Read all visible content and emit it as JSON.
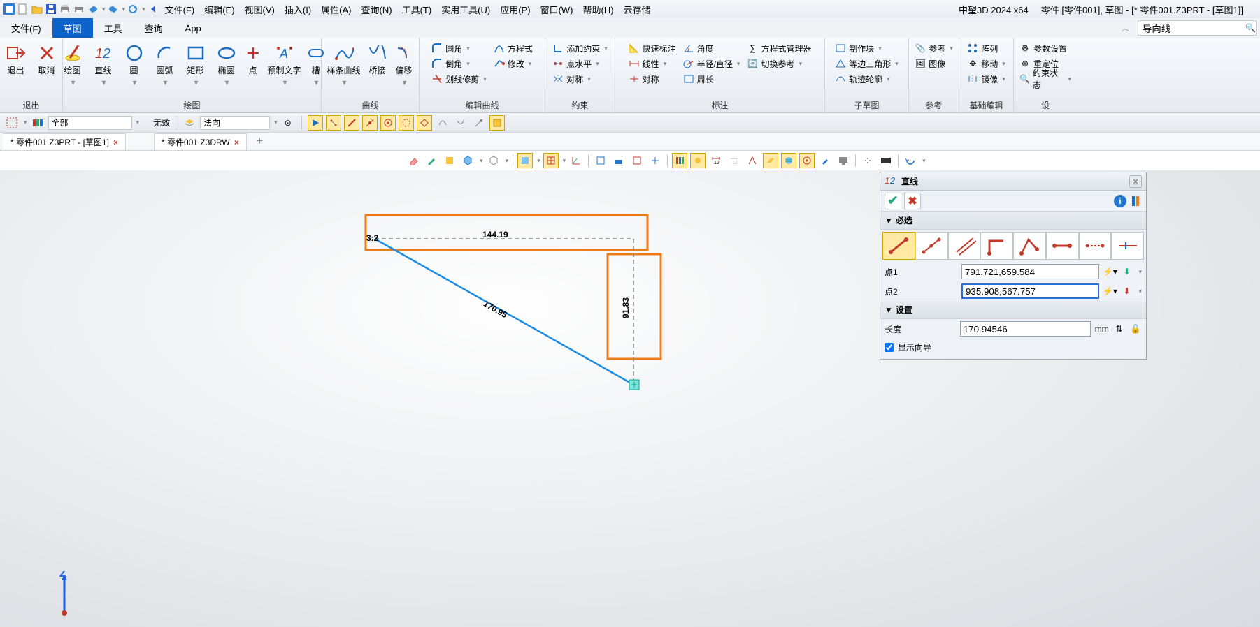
{
  "title": {
    "app": "中望3D 2024 x64",
    "doc": "零件 [零件001], 草图 - [* 零件001.Z3PRT - [草图1]]"
  },
  "menus": [
    "文件(F)",
    "编辑(E)",
    "视图(V)",
    "插入(I)",
    "属性(A)",
    "查询(N)",
    "工具(T)",
    "实用工具(U)",
    "应用(P)",
    "窗口(W)",
    "帮助(H)",
    "云存储"
  ],
  "tabs": [
    "文件(F)",
    "草图",
    "工具",
    "查询",
    "App"
  ],
  "search": {
    "placeholder": "导向线"
  },
  "ribbon": {
    "g1": {
      "exit": "退出",
      "cancel": "取消",
      "label": "退出"
    },
    "g2": {
      "draw": "绘图",
      "line": "直线",
      "circle": "圆",
      "arc": "圆弧",
      "rect": "矩形",
      "ellipse": "椭圆",
      "point": "点",
      "text": "预制文字",
      "slot": "槽",
      "label": "绘图"
    },
    "g3": {
      "spline": "样条曲线",
      "bridge": "桥接",
      "offset": "偏移",
      "label": "曲线"
    },
    "g4": {
      "fillet": "圆角",
      "chamfer": "倒角",
      "trim": "划线修剪",
      "label": "编辑曲线",
      "eq": "方程式",
      "mod": "修改"
    },
    "g5": {
      "addc": "添加约束",
      "pth": "点水平",
      "sym": "对称",
      "label": "约束"
    },
    "g6": {
      "quick": "快速标注",
      "linear": "线性",
      "symm": "对称",
      "angle": "角度",
      "rad": "半径/直径",
      "perim": "周长",
      "eqmgr": "方程式管理器",
      "swparam": "切换参考",
      "label": "标注"
    },
    "g7": {
      "mkblk": "制作块",
      "eqtri": "等边三角形",
      "trace": "轨迹轮廓",
      "label": "子草图"
    },
    "g8": {
      "ref": "参考",
      "img": "图像",
      "label": "参考"
    },
    "g9": {
      "array": "阵列",
      "move": "移动",
      "mirror": "镜像",
      "label": "基础编辑"
    },
    "g10": {
      "param": "参数设置",
      "reloc": "重定位",
      "cstate": "约束状态",
      "label": "设"
    }
  },
  "quick": {
    "all": "全部",
    "none": "无效",
    "normal": "法向"
  },
  "doctabs": {
    "t1": "* 零件001.Z3PRT - [草图1]",
    "t2": "* 零件001.Z3DRW"
  },
  "dims": {
    "h": "144.19",
    "d": "170.95",
    "v": "91.83",
    "p": "3:2"
  },
  "panel": {
    "title": "直线",
    "req": "必选",
    "p1": "点1",
    "p1v": "791.721,659.584",
    "p2": "点2",
    "p2v": "935.908,567.757",
    "set": "设置",
    "len": "长度",
    "lenv": "170.94546",
    "unit": "mm",
    "show": "显示向导"
  }
}
